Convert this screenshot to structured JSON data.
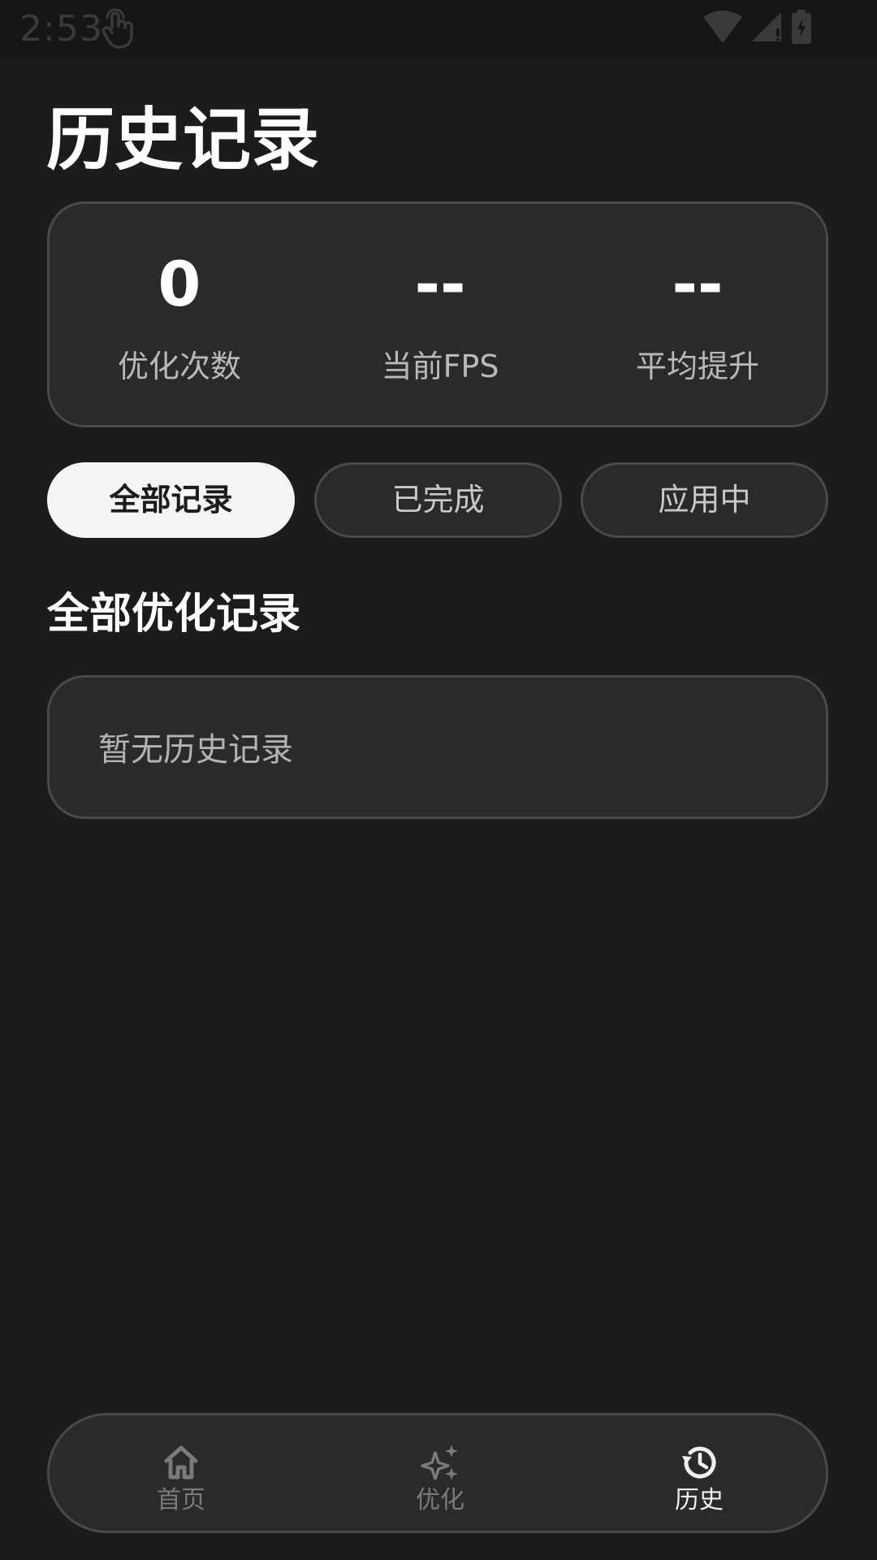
{
  "status_bar": {
    "time": "2:53"
  },
  "page": {
    "title": "历史记录"
  },
  "stats": [
    {
      "value": "0",
      "label": "优化次数"
    },
    {
      "value": "--",
      "label": "当前FPS"
    },
    {
      "value": "--",
      "label": "平均提升"
    }
  ],
  "tabs": [
    {
      "label": "全部记录",
      "active": true
    },
    {
      "label": "已完成",
      "active": false
    },
    {
      "label": "应用中",
      "active": false
    }
  ],
  "section": {
    "title": "全部优化记录",
    "empty_text": "暂无历史记录"
  },
  "bottom_nav": [
    {
      "label": "首页",
      "icon": "home-icon",
      "active": false
    },
    {
      "label": "优化",
      "icon": "sparkle-icon",
      "active": false
    },
    {
      "label": "历史",
      "icon": "history-icon",
      "active": true
    }
  ],
  "colors": {
    "background": "#1c1c1c",
    "card": "#2a2a2a",
    "border": "#4a4a4a",
    "active_tab": "#f5f5f5",
    "text_primary": "#ffffff",
    "text_secondary": "#b9b9b9"
  }
}
